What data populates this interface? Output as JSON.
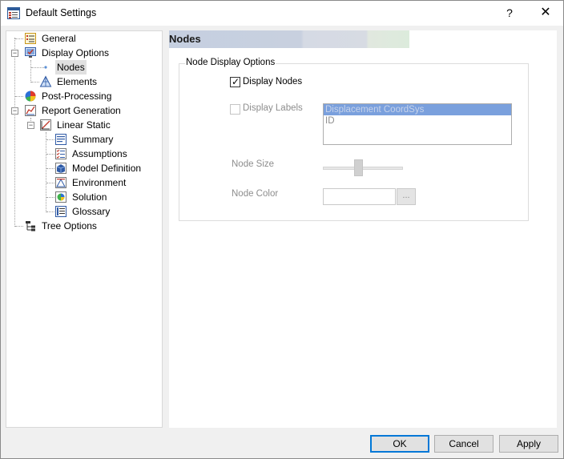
{
  "window": {
    "title": "Default Settings",
    "help_label": "?",
    "close_label": "✕"
  },
  "tree": {
    "items": [
      {
        "label": "General",
        "icon": "general-icon"
      },
      {
        "label": "Display Options",
        "icon": "display-options-icon"
      },
      {
        "label": "Nodes",
        "icon": "node-dot-icon",
        "selected": true
      },
      {
        "label": "Elements",
        "icon": "elements-icon"
      },
      {
        "label": "Post-Processing",
        "icon": "post-processing-icon"
      },
      {
        "label": "Report Generation",
        "icon": "report-generation-icon"
      },
      {
        "label": "Linear Static",
        "icon": "linear-static-icon"
      },
      {
        "label": "Summary",
        "icon": "summary-icon"
      },
      {
        "label": "Assumptions",
        "icon": "assumptions-icon"
      },
      {
        "label": "Model Definition",
        "icon": "model-definition-icon"
      },
      {
        "label": "Environment",
        "icon": "environment-icon"
      },
      {
        "label": "Solution",
        "icon": "solution-icon"
      },
      {
        "label": "Glossary",
        "icon": "glossary-icon"
      },
      {
        "label": "Tree Options",
        "icon": "tree-options-icon"
      }
    ],
    "expander_minus": "−"
  },
  "panel": {
    "title": "Nodes",
    "group_title": "Node Display Options",
    "display_nodes_label": "Display Nodes",
    "display_nodes_checked": true,
    "check_glyph": "✓",
    "display_labels_label": "Display Labels",
    "display_labels_checked": false,
    "labels_list": [
      "Displacement CoordSys",
      "ID"
    ],
    "node_size_label": "Node Size",
    "node_color_label": "Node Color",
    "color_button_label": "..."
  },
  "buttons": {
    "ok": "OK",
    "cancel": "Cancel",
    "apply": "Apply"
  },
  "colors": {
    "default_button_border": "#0078d7",
    "list_selection": "#7aa0dd",
    "banner": "#c5cfe0"
  }
}
